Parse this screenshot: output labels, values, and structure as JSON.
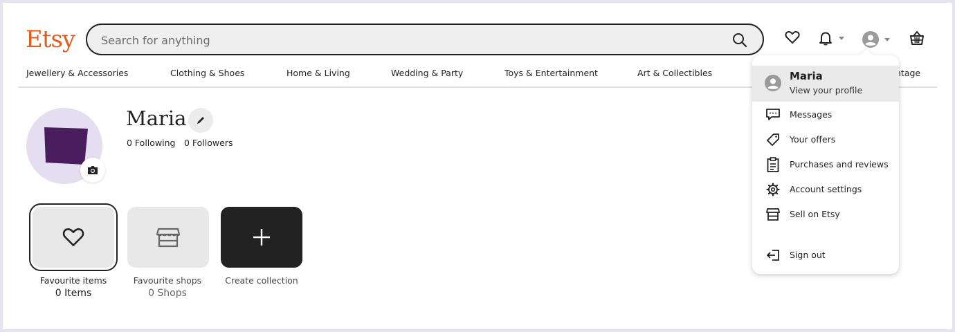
{
  "header": {
    "logo": "Etsy",
    "search_placeholder": "Search for anything"
  },
  "nav": {
    "items": [
      "Jewellery & Accessories",
      "Clothing & Shoes",
      "Home & Living",
      "Wedding & Party",
      "Toys & Entertainment",
      "Art & Collectibles",
      "ntage"
    ]
  },
  "profile": {
    "name": "Maria",
    "following": "0 Following",
    "followers": "0 Followers"
  },
  "collections": [
    {
      "label": "Favourite items",
      "count": "0 Items"
    },
    {
      "label": "Favourite shops",
      "count": "0 Shops"
    },
    {
      "label": "Create collection"
    }
  ],
  "menu": {
    "profile_name": "Maria",
    "profile_sub": "View your profile",
    "items": [
      "Messages",
      "Your offers",
      "Purchases and reviews",
      "Account settings",
      "Sell on Etsy"
    ],
    "sign_out": "Sign out"
  },
  "colors": {
    "brand": "#e25c1d",
    "avatar_bg": "#e5def0",
    "avatar_shape": "#4a1e5e"
  }
}
